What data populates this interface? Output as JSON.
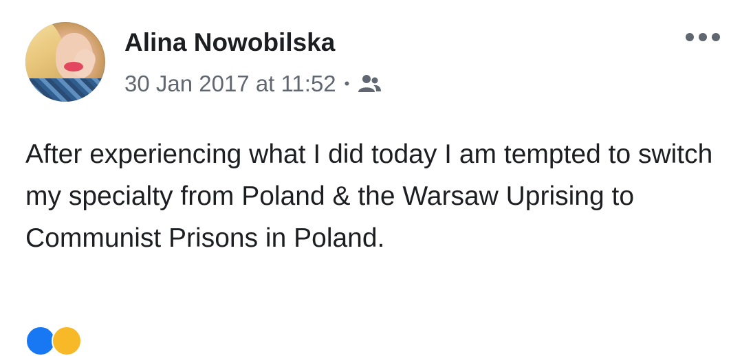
{
  "post": {
    "author_name": "Alina Nowobilska",
    "timestamp": "30 Jan 2017 at 11:52",
    "separator": "•",
    "audience_icon": "friends-icon",
    "more_icon": "more-options-icon",
    "text": "After experiencing what I did today I am tempted to switch my specialty from Poland & the Warsaw Uprising to Communist Prisons in Poland.",
    "reactions": [
      "like-icon",
      "haha-icon"
    ]
  },
  "colors": {
    "primary_text": "#1c1e21",
    "secondary_text": "#606770",
    "like_blue": "#1877f2",
    "haha_yellow": "#f7b928"
  }
}
